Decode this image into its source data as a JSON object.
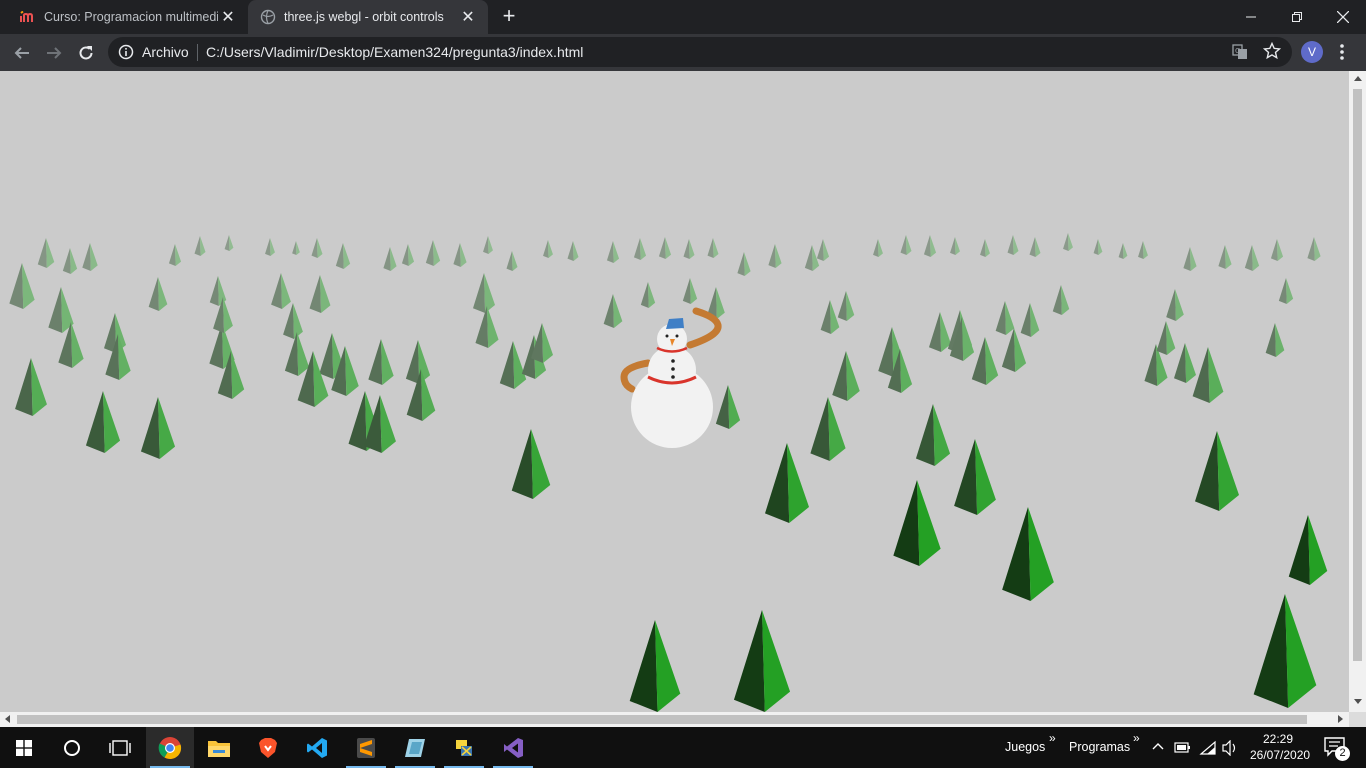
{
  "browser": {
    "tabs": [
      {
        "title": "Curso: Programacion multimedia",
        "favicon": "udemy-icon",
        "active": false
      },
      {
        "title": "three.js webgl - orbit controls",
        "favicon": "globe-icon",
        "active": true
      }
    ],
    "new_tab_label": "+",
    "window_controls": {
      "minimize": "minimize-icon",
      "maximize": "restore-icon",
      "close": "close-icon"
    },
    "omnibox": {
      "site_label": "Archivo",
      "url": "C:/Users/Vladimir/Desktop/Examen324/pregunta3/index.html"
    },
    "profile_initial": "V"
  },
  "scene": {
    "background_color": "#cbcbcb",
    "tree_color": "#1f9a1f",
    "snowman_body_color": "#f2f2f2",
    "scarf_color": "#d9342b",
    "hat_color": "#3f7fc6",
    "arm_color": "#c47a32"
  },
  "taskbar": {
    "apps": [
      "start-icon",
      "cortana-icon",
      "task-view-icon",
      "chrome-icon",
      "file-explorer-icon",
      "brave-icon",
      "vscode-icon",
      "sublime-icon",
      "app-icon",
      "python-icon",
      "visual-studio-icon"
    ],
    "toolbars": [
      {
        "label": "Juegos",
        "chevron": "»"
      },
      {
        "label": "Programas",
        "chevron": "»"
      }
    ],
    "clock": {
      "time": "22:29",
      "date": "26/07/2020"
    },
    "notification_count": "2"
  }
}
